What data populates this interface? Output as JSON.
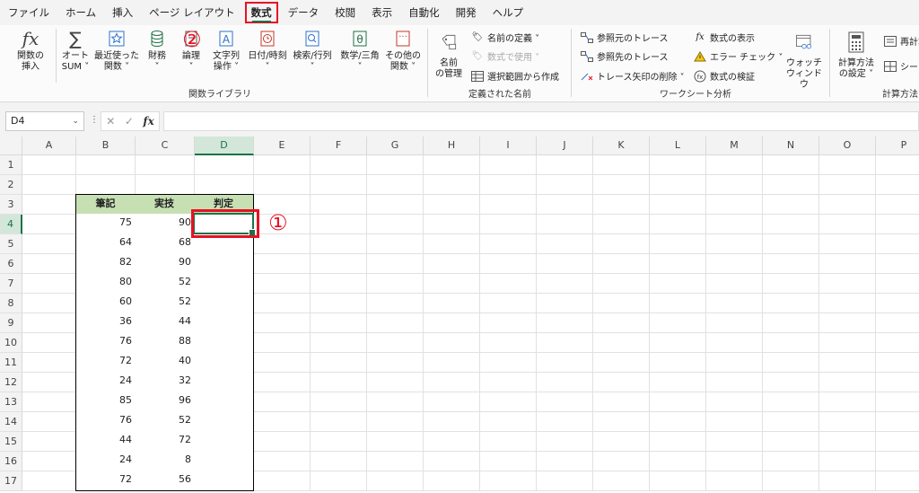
{
  "menu": {
    "tabs": [
      {
        "label": "ファイル"
      },
      {
        "label": "ホーム"
      },
      {
        "label": "挿入"
      },
      {
        "label": "ページ レイアウト"
      },
      {
        "label": "数式",
        "active": true
      },
      {
        "label": "データ"
      },
      {
        "label": "校閲"
      },
      {
        "label": "表示"
      },
      {
        "label": "自動化"
      },
      {
        "label": "開発"
      },
      {
        "label": "ヘルプ"
      }
    ]
  },
  "ribbon": {
    "function_library": {
      "insert_function": {
        "line1": "関数の",
        "line2": "挿入",
        "icon": "fx-icon"
      },
      "autosum": {
        "line1": "オート",
        "line2": "SUM ˅",
        "icon": "sigma-icon"
      },
      "recent": {
        "line1": "最近使った",
        "line2": "関数 ˅",
        "icon": "star-icon"
      },
      "financial": {
        "line1": "財務",
        "line2": "˅",
        "icon": "database-icon"
      },
      "logical": {
        "line1": "論理",
        "line2": "˅",
        "icon": "book-icon"
      },
      "text": {
        "line1": "文字列",
        "line2": "操作 ˅",
        "icon": "text-icon"
      },
      "datetime": {
        "line1": "日付/時刻",
        "line2": "˅",
        "icon": "clock-icon"
      },
      "lookup": {
        "line1": "検索/行列",
        "line2": "˅",
        "icon": "search-icon"
      },
      "math": {
        "line1": "数学/三角",
        "line2": "˅",
        "icon": "theta-icon"
      },
      "more": {
        "line1": "その他の",
        "line2": "関数 ˅",
        "icon": "more-icon"
      },
      "group_label": "関数ライブラリ"
    },
    "defined_names": {
      "name_manager": {
        "line1": "名前",
        "line2": "の管理"
      },
      "define_name": "名前の定義 ˅",
      "use_in_formula": "数式で使用 ˅",
      "create_from_selection": "選択範囲から作成",
      "group_label": "定義された名前"
    },
    "formula_auditing": {
      "trace_precedents": "参照元のトレース",
      "trace_dependents": "参照先のトレース",
      "remove_arrows": "トレース矢印の削除 ˅",
      "show_formulas": "数式の表示",
      "error_checking": "エラー チェック ˅",
      "evaluate_formula": "数式の検証",
      "watch_window": {
        "line1": "ウォッチ",
        "line2": "ウィンドウ"
      },
      "group_label": "ワークシート分析"
    },
    "calculation": {
      "calc_options": {
        "line1": "計算方法",
        "line2": "の設定 ˅"
      },
      "recalc": "再計算",
      "calc_sheet": "シート",
      "group_label": "計算方法"
    }
  },
  "formula_bar": {
    "name_box": "D4",
    "fx": "fx",
    "cancel": "✕",
    "enter": "✓",
    "value": ""
  },
  "sheet": {
    "columns": [
      "A",
      "B",
      "C",
      "D",
      "E",
      "F",
      "G",
      "H",
      "I",
      "J",
      "K",
      "L",
      "M",
      "N",
      "O",
      "P"
    ],
    "rows": [
      "1",
      "2",
      "3",
      "4",
      "5",
      "6",
      "7",
      "8",
      "9",
      "10",
      "11",
      "12",
      "13",
      "14",
      "15",
      "16",
      "17"
    ],
    "selected_column": "D",
    "selected_row": "4",
    "table_headers": [
      "筆記",
      "実技",
      "判定"
    ],
    "table_rows": [
      [
        "75",
        "90",
        ""
      ],
      [
        "64",
        "68",
        ""
      ],
      [
        "82",
        "90",
        ""
      ],
      [
        "80",
        "52",
        ""
      ],
      [
        "60",
        "52",
        ""
      ],
      [
        "36",
        "44",
        ""
      ],
      [
        "76",
        "88",
        ""
      ],
      [
        "72",
        "40",
        ""
      ],
      [
        "24",
        "32",
        ""
      ],
      [
        "85",
        "96",
        ""
      ],
      [
        "76",
        "52",
        ""
      ],
      [
        "44",
        "72",
        ""
      ],
      [
        "24",
        "8",
        ""
      ],
      [
        "72",
        "56",
        ""
      ]
    ]
  },
  "annotations": {
    "step1": "①",
    "step2": "②",
    "accent": "#e81123"
  }
}
